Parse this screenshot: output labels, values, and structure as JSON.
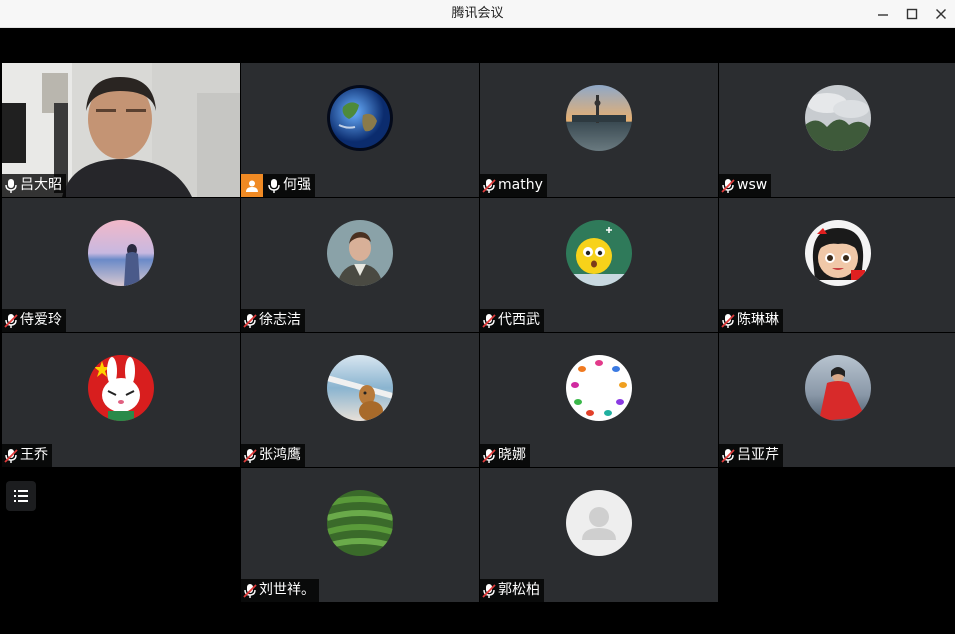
{
  "window": {
    "title": "腾讯会议"
  },
  "participants": [
    {
      "name": "吕大昭",
      "mic": "on",
      "host": false,
      "video": true
    },
    {
      "name": "何强",
      "mic": "on",
      "host": true,
      "avatar": "earth"
    },
    {
      "name": "mathy",
      "mic": "muted",
      "avatar": "city-sunset"
    },
    {
      "name": "wsw",
      "mic": "muted",
      "avatar": "mountain-clouds"
    },
    {
      "name": "侍爱玲",
      "mic": "muted",
      "avatar": "beach-girl"
    },
    {
      "name": "徐志洁",
      "mic": "muted",
      "avatar": "man-suit"
    },
    {
      "name": "代西武",
      "mic": "muted",
      "avatar": "emoji-blackboard"
    },
    {
      "name": "陈琳琳",
      "mic": "muted",
      "avatar": "cartoon-girl"
    },
    {
      "name": "王乔",
      "mic": "muted",
      "avatar": "rabbit-flag"
    },
    {
      "name": "张鸿鹰",
      "mic": "muted",
      "avatar": "dog-boat"
    },
    {
      "name": "晓娜",
      "mic": "muted",
      "avatar": "butterfly-ring"
    },
    {
      "name": "吕亚芹",
      "mic": "muted",
      "avatar": "woman-red-scarf"
    },
    {
      "name": "刘世祥。",
      "mic": "muted",
      "avatar": "tea-field"
    },
    {
      "name": "郭松柏",
      "mic": "muted",
      "avatar": "default-person"
    }
  ],
  "icons": {
    "minimize": "minimize-icon",
    "maximize": "maximize-icon",
    "close": "close-icon",
    "list": "list-icon"
  },
  "colors": {
    "titlebar": "#f7f7f7",
    "tile": "#2b2d30",
    "host_badge": "#f08a24",
    "mute": "#e03c3c"
  }
}
